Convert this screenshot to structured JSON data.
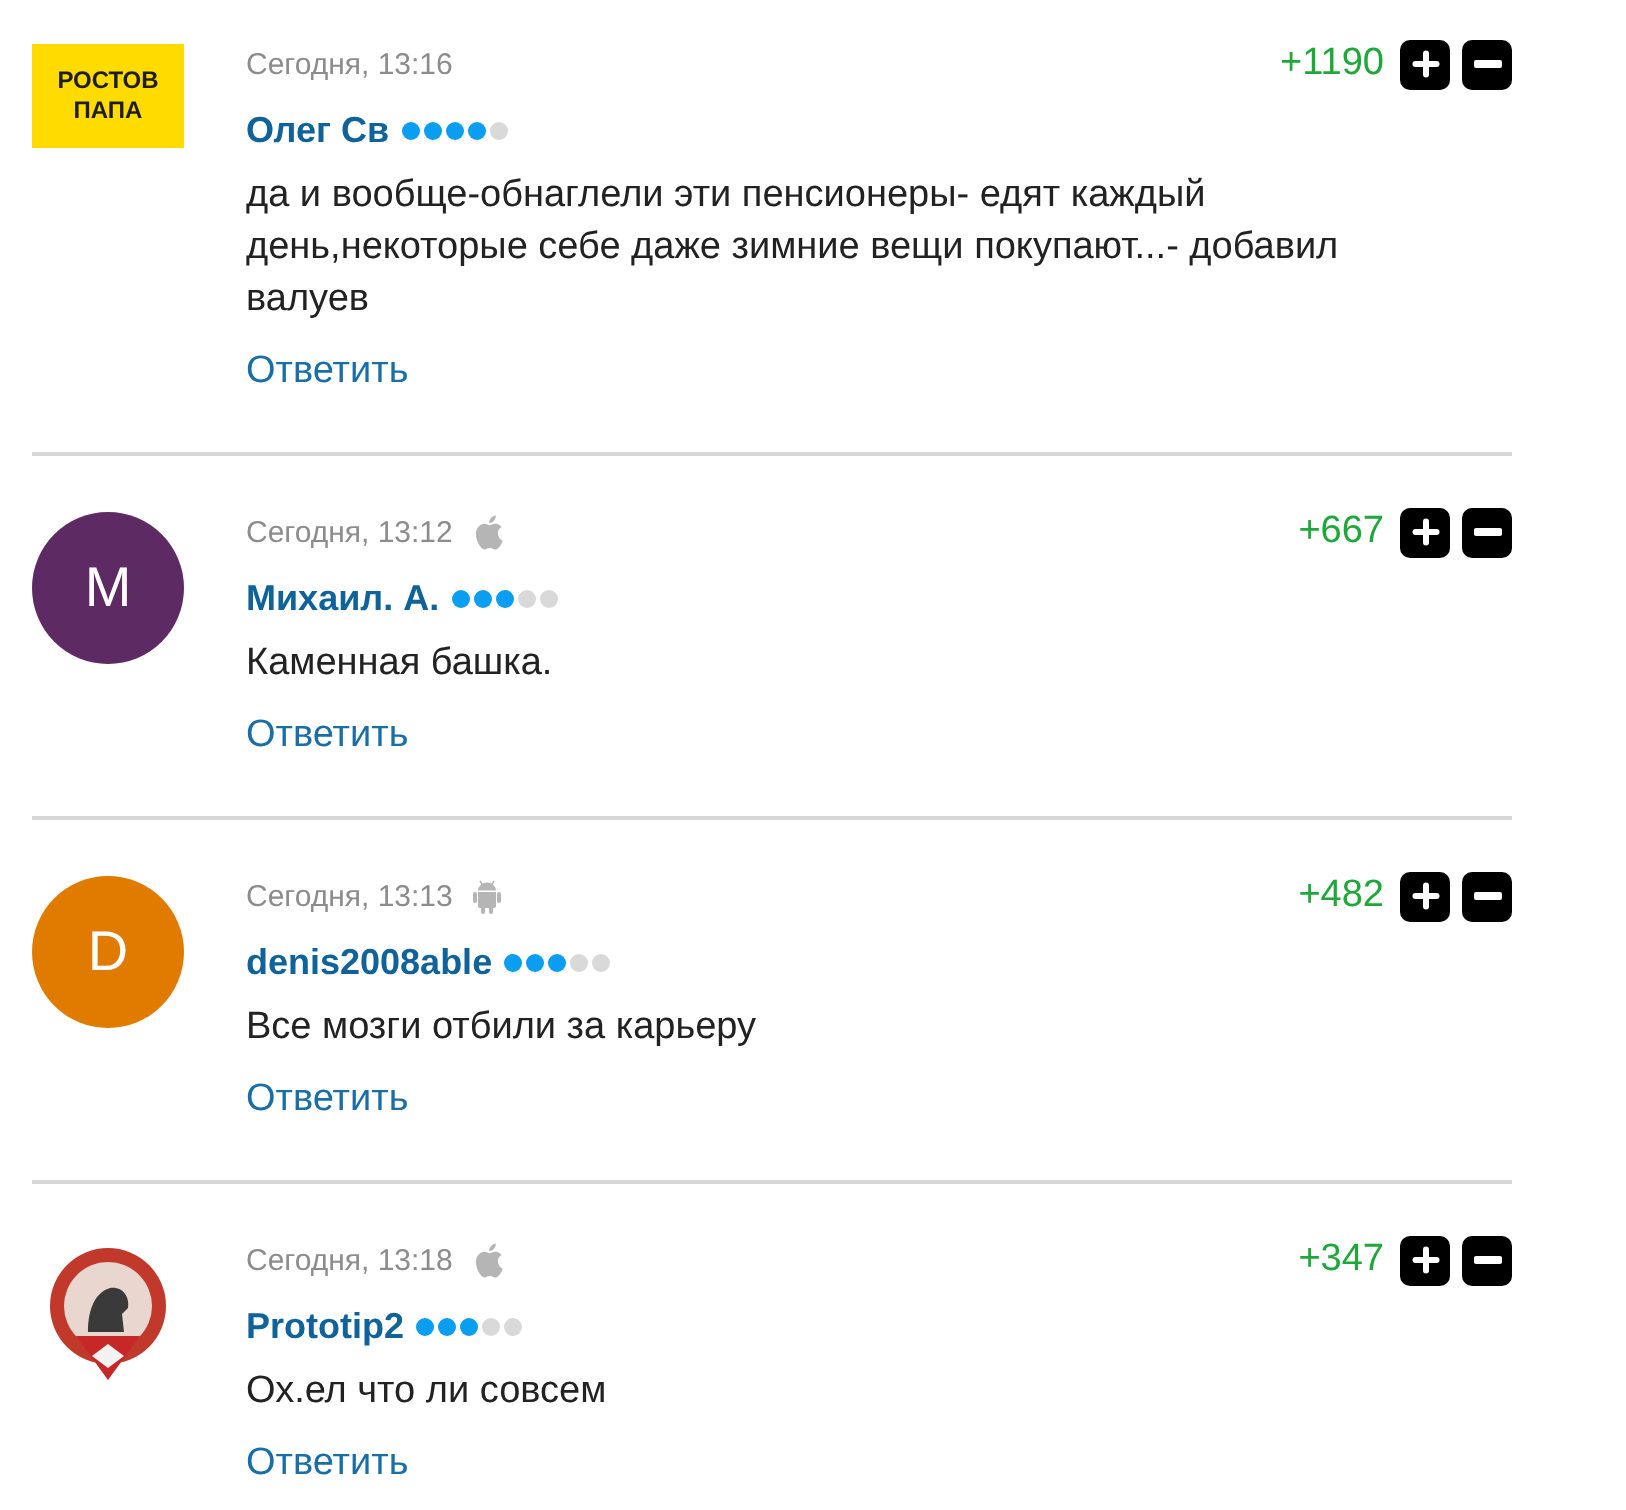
{
  "comments": [
    {
      "avatar": {
        "kind": "logo",
        "lines": [
          "РОСТОВ",
          "ПАПА"
        ]
      },
      "date": "Сегодня, 13:16",
      "author": "Олег Св",
      "stars": 4,
      "text": "да и вообще-обнаглели эти пенсионеры- едят каждый день,некоторые себе даже зимние вещи покупают...- добавил валуев",
      "score": "+1190",
      "reply": "Ответить"
    },
    {
      "avatar": {
        "kind": "letter",
        "letter": "M",
        "color": "#5e2a63"
      },
      "date": "Сегодня, 13:12",
      "device": {
        "kind": "apple"
      },
      "author": "Михаил. А.",
      "stars": 3,
      "text": "Каменная башка.",
      "score": "+667",
      "reply": "Ответить"
    },
    {
      "avatar": {
        "kind": "letter",
        "letter": "D",
        "color": "#e07b00"
      },
      "date": "Сегодня, 13:13",
      "device": {
        "kind": "android"
      },
      "author": "denis2008able",
      "stars": 3,
      "text": "Все мозги отбили за карьеру",
      "score": "+482",
      "reply": "Ответить"
    },
    {
      "avatar": {
        "kind": "emblem"
      },
      "date": "Сегодня, 13:18",
      "device": {
        "kind": "apple"
      },
      "author": "Prototip2",
      "stars": 3,
      "text": "Ох.ел что ли совсем",
      "score": "+347",
      "reply": "Ответить"
    }
  ]
}
